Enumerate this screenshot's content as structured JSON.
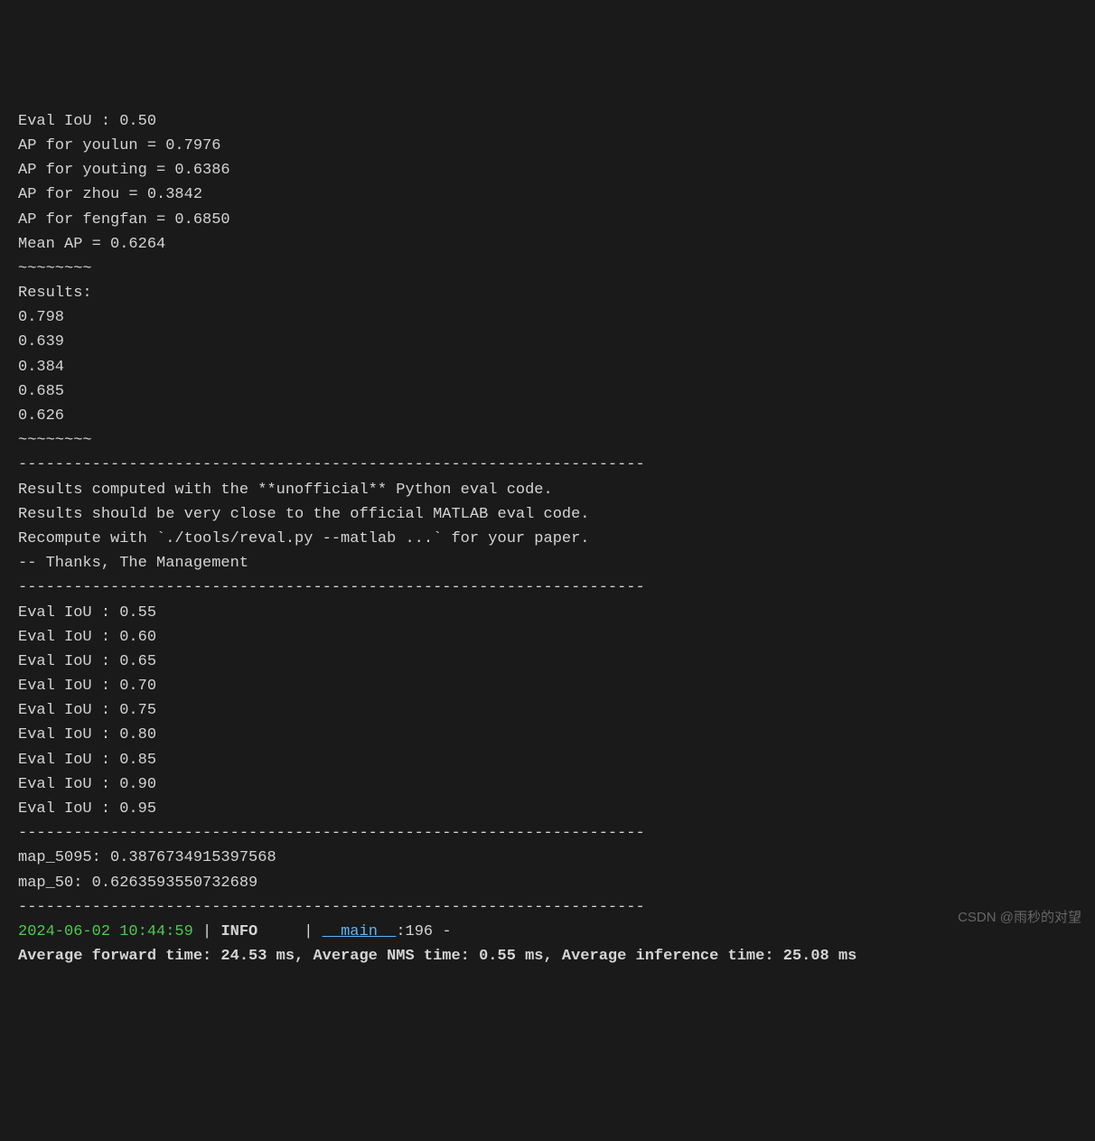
{
  "lines": {
    "eval_iou_50": "Eval IoU : 0.50",
    "ap_youlun": "AP for youlun = 0.7976",
    "ap_youting": "AP for youting = 0.6386",
    "ap_zhou": "AP for zhou = 0.3842",
    "ap_fengfan": "AP for fengfan = 0.6850",
    "mean_ap": "Mean AP = 0.6264",
    "tilde1": "~~~~~~~~",
    "results_header": "Results:",
    "r1": "0.798",
    "r2": "0.639",
    "r3": "0.384",
    "r4": "0.685",
    "r5": "0.626",
    "tilde2": "~~~~~~~~",
    "blank1": "",
    "dash1": "--------------------------------------------------------------------",
    "note1": "Results computed with the **unofficial** Python eval code.",
    "note2": "Results should be very close to the official MATLAB eval code.",
    "note3": "Recompute with `./tools/reval.py --matlab ...` for your paper.",
    "note4": "-- Thanks, The Management",
    "dash2": "--------------------------------------------------------------------",
    "eval_55": "Eval IoU : 0.55",
    "eval_60": "Eval IoU : 0.60",
    "eval_65": "Eval IoU : 0.65",
    "eval_70": "Eval IoU : 0.70",
    "eval_75": "Eval IoU : 0.75",
    "eval_80": "Eval IoU : 0.80",
    "eval_85": "Eval IoU : 0.85",
    "eval_90": "Eval IoU : 0.90",
    "eval_95": "Eval IoU : 0.95",
    "dash3": "--------------------------------------------------------------------",
    "map_5095": "map_5095: 0.3876734915397568",
    "map_50": "map_50: 0.6263593550732689",
    "dash4": "--------------------------------------------------------------------",
    "timestamp": "2024-06-02 10:44:59",
    "pipe1": " | ",
    "info_label": "INFO",
    "pipe2": "     | ",
    "main_module": "__main__",
    "line_ref": ":196 -",
    "timing": "Average forward time: 24.53 ms, Average NMS time: 0.55 ms, Average inference time: 25.08 ms"
  },
  "watermark": "CSDN @雨秒的对望"
}
